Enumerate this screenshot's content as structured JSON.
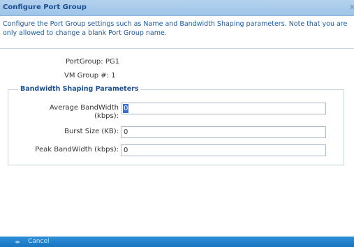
{
  "dialog": {
    "title": "Configure Port Group",
    "close_icon": "close-icon",
    "intro": "Configure the Port Group settings such as Name and Bandwidth Shaping parameters. Note that you are only allowed to change a blank Port Group name."
  },
  "info": {
    "port_group_label": "PortGroup:",
    "port_group_value": "PG1",
    "vm_group_label": "VM Group #:",
    "vm_group_value": "1"
  },
  "bandwidth": {
    "legend": "Bandwidth Shaping Parameters",
    "average_label_line1": "Average BandWidth",
    "average_label_line2": "(kbps):",
    "average_value": "0",
    "burst_label": "Burst Size (KB):",
    "burst_value": "0",
    "peak_label": "Peak BandWidth (kbps):",
    "peak_value": "0"
  },
  "footer": {
    "separator_icon": "separator-icon",
    "cancel_label": "Cancel"
  }
}
